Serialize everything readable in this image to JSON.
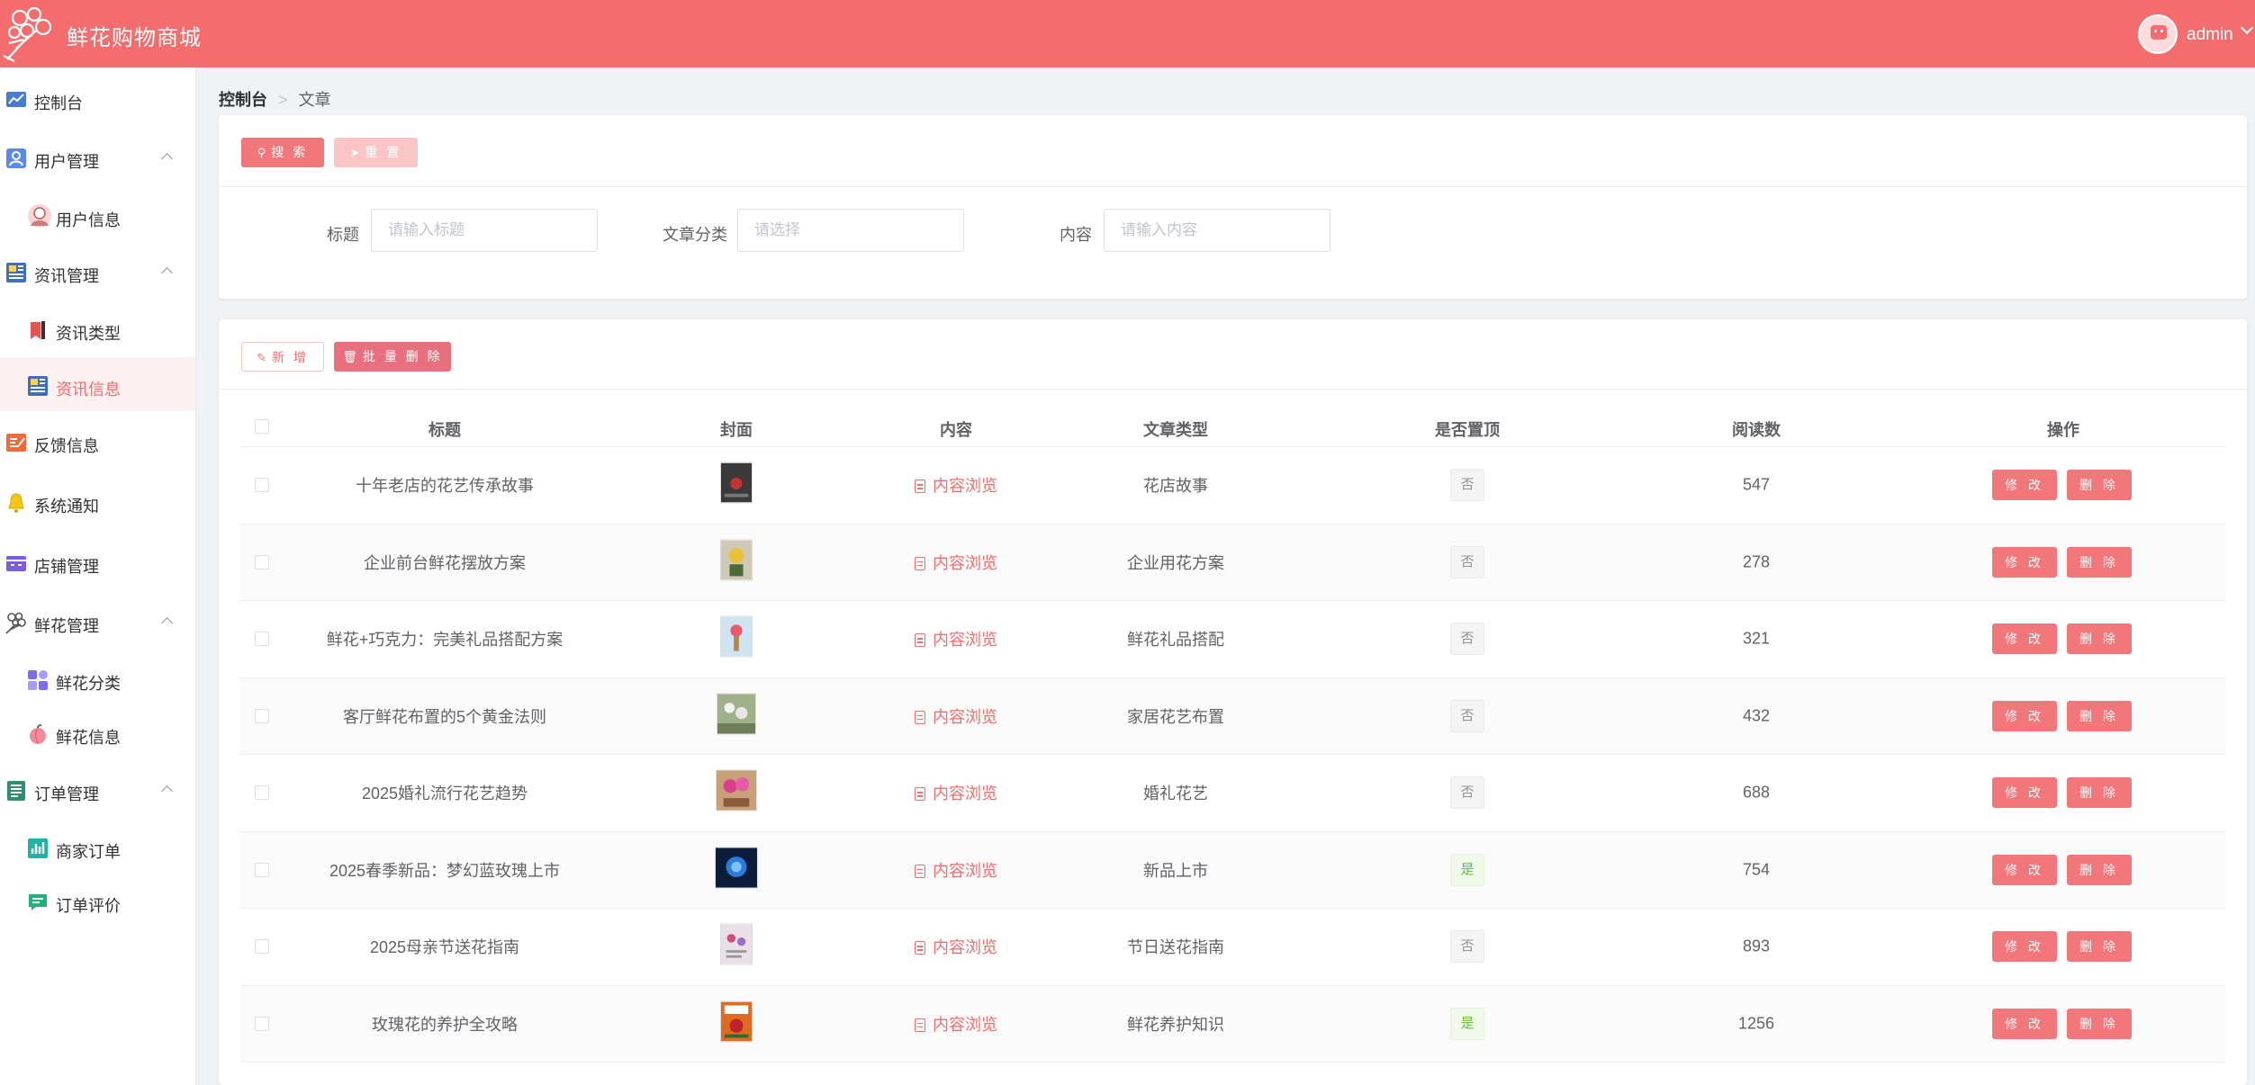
{
  "header": {
    "brand": "鲜花购物商城",
    "username": "admin"
  },
  "sidebar": {
    "items": [
      {
        "label": "控制台"
      },
      {
        "label": "用户管理"
      },
      {
        "label": "用户信息"
      },
      {
        "label": "资讯管理"
      },
      {
        "label": "资讯类型"
      },
      {
        "label": "资讯信息"
      },
      {
        "label": "反馈信息"
      },
      {
        "label": "系统通知"
      },
      {
        "label": "店铺管理"
      },
      {
        "label": "鲜花管理"
      },
      {
        "label": "鲜花分类"
      },
      {
        "label": "鲜花信息"
      },
      {
        "label": "订单管理"
      },
      {
        "label": "商家订单"
      },
      {
        "label": "订单评价"
      }
    ]
  },
  "breadcrumb": {
    "home": "控制台",
    "current": "文章"
  },
  "search": {
    "search_label": "搜 索",
    "reset_label": "重 置",
    "fields": [
      {
        "label": "标题",
        "placeholder": "请输入标题"
      },
      {
        "label": "文章分类",
        "placeholder": "请选择"
      },
      {
        "label": "内容",
        "placeholder": "请输入内容"
      }
    ]
  },
  "toolbar": {
    "add_label": "新 增",
    "batch_delete_label": "批 量 删 除"
  },
  "table": {
    "columns": [
      "标题",
      "封面",
      "内容",
      "文章类型",
      "是否置顶",
      "阅读数",
      "操作"
    ],
    "view_label": "内容浏览",
    "edit_label": "修 改",
    "delete_label": "删 除",
    "rows": [
      {
        "title": "十年老店的花艺传承故事",
        "type": "花店故事",
        "top": "否",
        "reads": "547"
      },
      {
        "title": "企业前台鲜花摆放方案",
        "type": "企业用花方案",
        "top": "否",
        "reads": "278"
      },
      {
        "title": "鲜花+巧克力：完美礼品搭配方案",
        "type": "鲜花礼品搭配",
        "top": "否",
        "reads": "321"
      },
      {
        "title": "客厅鲜花布置的5个黄金法则",
        "type": "家居花艺布置",
        "top": "否",
        "reads": "432"
      },
      {
        "title": "2025婚礼流行花艺趋势",
        "type": "婚礼花艺",
        "top": "否",
        "reads": "688"
      },
      {
        "title": "2025春季新品：梦幻蓝玫瑰上市",
        "type": "新品上市",
        "top": "是",
        "reads": "754"
      },
      {
        "title": "2025母亲节送花指南",
        "type": "节日送花指南",
        "top": "否",
        "reads": "893"
      },
      {
        "title": "玫瑰花的养护全攻略",
        "type": "鲜花养护知识",
        "top": "是",
        "reads": "1256"
      }
    ]
  },
  "colors": {
    "primary": "#f36d6e",
    "action": "#f1777a",
    "success": "#67c23a"
  }
}
